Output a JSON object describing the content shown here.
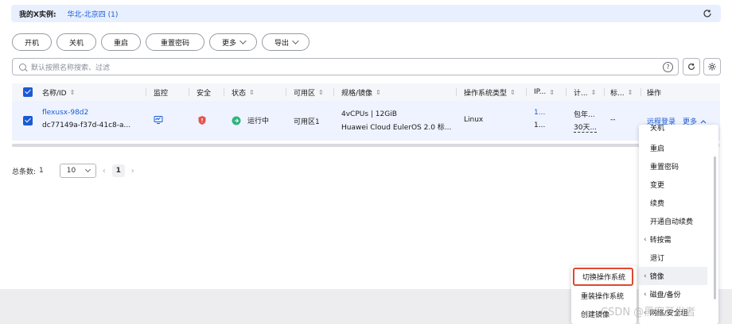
{
  "region": {
    "label": "我的X实例:",
    "value": "华北-北京四 (1)"
  },
  "actions": [
    {
      "label": "开机",
      "dropdown": false
    },
    {
      "label": "关机",
      "dropdown": false
    },
    {
      "label": "重启",
      "dropdown": false
    },
    {
      "label": "重置密码",
      "dropdown": false
    },
    {
      "label": "更多",
      "dropdown": true
    },
    {
      "label": "导出",
      "dropdown": true
    }
  ],
  "search": {
    "placeholder": "默认按照名称搜索、过滤"
  },
  "table": {
    "headers": {
      "name": "名称/ID",
      "monitor": "监控",
      "security": "安全",
      "status": "状态",
      "az": "可用区",
      "spec": "规格/镜像",
      "os_type": "操作系统类型",
      "ip": "IP...",
      "billing": "计...",
      "tags": "标...",
      "ops": "操作"
    },
    "row": {
      "name": "flexusx-98d2",
      "id": "dc77149a-f37d-41c8-a...",
      "status": "运行中",
      "az": "可用区1",
      "spec_line1": "4vCPUs | 12GiB",
      "spec_line2": "Huawei Cloud EulerOS 2.0 标...",
      "os_type": "Linux",
      "ip1": "1...",
      "ip2": "1...",
      "billing1": "包年...",
      "billing2": "30天...",
      "tags": "--",
      "remote_login": "远程登录",
      "more": "更多"
    }
  },
  "pager": {
    "total_label": "总条数:",
    "total": "1",
    "page_size": "10",
    "current_page": "1"
  },
  "more_menu": {
    "items": [
      {
        "label": "关机",
        "sub": false
      },
      {
        "label": "重启",
        "sub": false
      },
      {
        "label": "重置密码",
        "sub": false
      },
      {
        "label": "变更",
        "sub": false
      },
      {
        "label": "续费",
        "sub": false
      },
      {
        "label": "开通自动续费",
        "sub": false
      },
      {
        "label": "转按需",
        "sub": true
      },
      {
        "label": "退订",
        "sub": false
      },
      {
        "label": "镜像",
        "sub": true
      },
      {
        "label": "磁盘/备份",
        "sub": true
      },
      {
        "label": "网络/安全组",
        "sub": true
      }
    ]
  },
  "image_submenu": {
    "items": [
      "切换操作系统",
      "重装操作系统",
      "创建镜像"
    ]
  },
  "watermark": "CSDN @黑客开发者",
  "colors": {
    "accent": "#1a5bd6",
    "highlight_border": "#e0482f",
    "status_running": "#2fb67c",
    "shield": "#e4544b"
  }
}
